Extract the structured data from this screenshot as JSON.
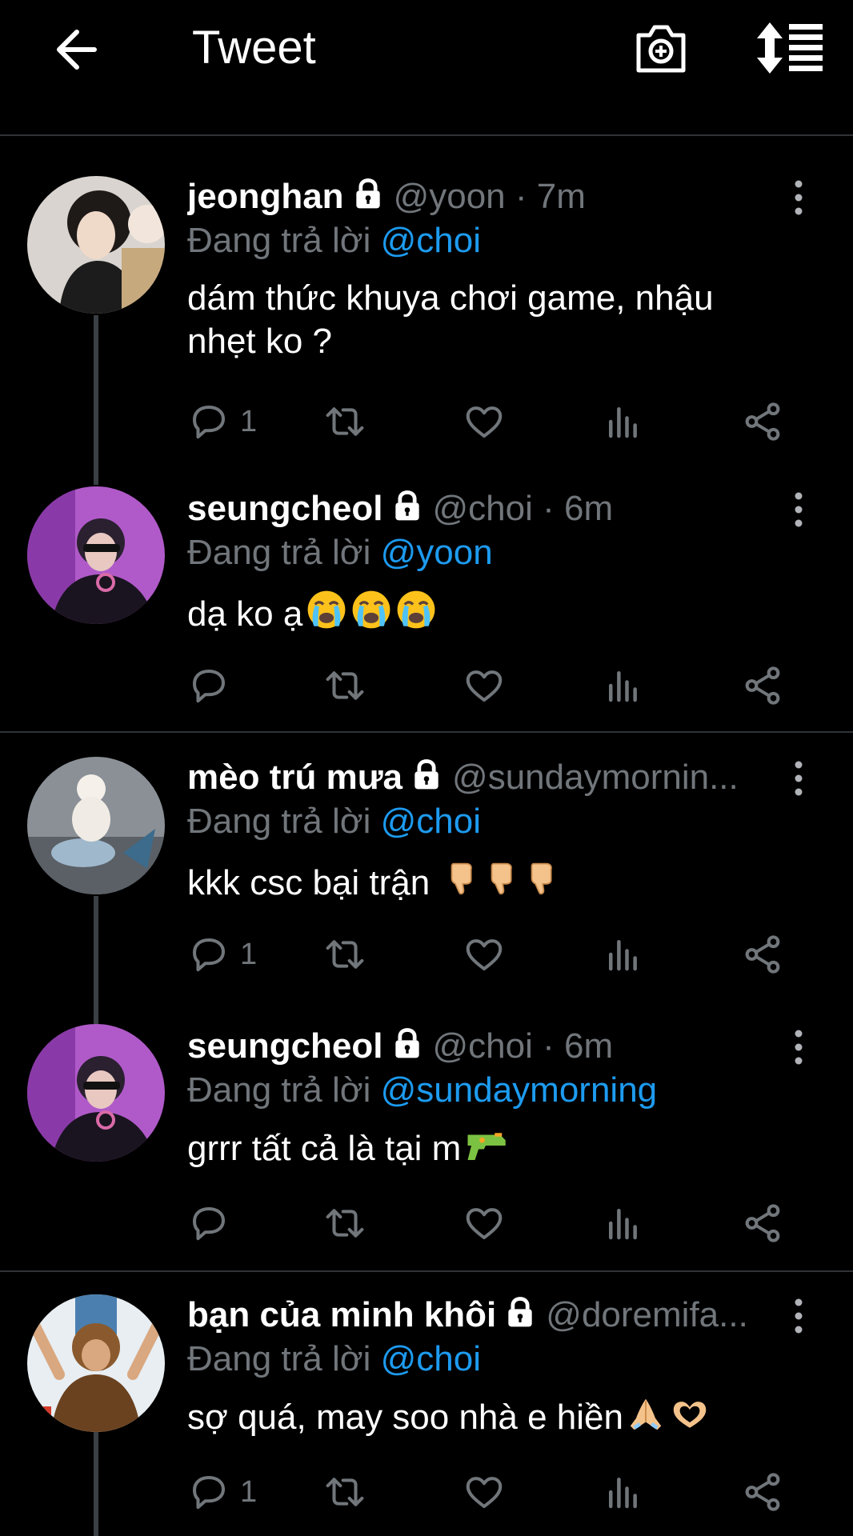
{
  "header": {
    "title": "Tweet",
    "back_icon": "arrow-left-icon",
    "camera_icon": "camera-plus-icon",
    "sort_icon": "sort-list-icon"
  },
  "colors": {
    "link": "#1d9bf0",
    "muted": "#71767b",
    "background": "#000000"
  },
  "reply_prefix": "Đang trả lời",
  "tweets": [
    {
      "username": "jeonghan",
      "handle": "@yoon · 7m",
      "reply_to": "@choi",
      "text1": "dám thức khuya chơi game, nhậu",
      "text2": "nhẹt ko ?",
      "reply_count": "1"
    },
    {
      "username": "seungcheol",
      "handle": "@choi · 6m",
      "reply_to": "@yoon",
      "text1": "dạ ko ạ",
      "emojis": "crying-face-emoji x3",
      "reply_count": ""
    },
    {
      "username": "mèo trú mưa",
      "handle": "@sundaymornin...",
      "reply_to": "@choi",
      "text1": "kkk csc bại trận",
      "emojis": "thumbs-down-emoji x3",
      "reply_count": "1"
    },
    {
      "username": "seungcheol",
      "handle": "@choi · 6m",
      "reply_to": "@sundaymorning",
      "text1": "grrr tất cả là tại m",
      "emojis": "water-pistol-emoji",
      "reply_count": ""
    },
    {
      "username": "bạn của minh khôi",
      "handle": "@doremifa...",
      "reply_to": "@choi",
      "text1": "sợ quá, may soo nhà e hiền",
      "emojis": "folded-hands-emoji, heart-hands-emoji",
      "reply_count": "1"
    }
  ]
}
